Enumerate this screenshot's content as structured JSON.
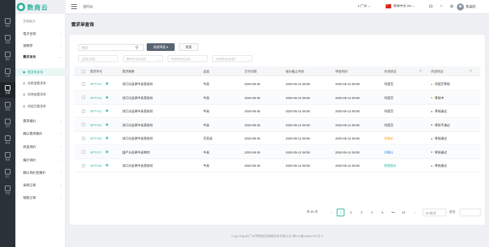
{
  "app": {
    "brand": "数商云",
    "colors": {
      "accent": "#2ab39e",
      "rail_bg": "#2b3138",
      "adv_btn": "#5a6572",
      "pending": "#f39c12",
      "ext_blue": "#3a8ee6"
    }
  },
  "rail": [
    {
      "label": "首页",
      "icon": "home-icon"
    },
    {
      "label": "商品",
      "icon": "goods-icon"
    },
    {
      "label": "报价",
      "icon": "quote-icon"
    },
    {
      "label": "订单",
      "icon": "order-icon"
    },
    {
      "label": "交易",
      "icon": "trade-icon"
    },
    {
      "label": "授信",
      "icon": "credit-icon"
    },
    {
      "label": "支付",
      "icon": "payment-icon"
    },
    {
      "label": "物流",
      "icon": "logistics-icon"
    },
    {
      "label": "账单",
      "icon": "bill-icon"
    },
    {
      "label": "加工",
      "icon": "process-icon"
    },
    {
      "label": "系统",
      "icon": "system-icon"
    }
  ],
  "menu": {
    "section_title": "交易助力",
    "items": [
      {
        "label": "电子合同"
      },
      {
        "label": "进销存"
      },
      {
        "label": "需求发布"
      },
      {
        "label": "需求报价"
      },
      {
        "label": "确认需求报价"
      },
      {
        "label": "商品询价"
      },
      {
        "label": "报价询价"
      },
      {
        "label": "确认询价且报价"
      },
      {
        "label": "采购订单"
      },
      {
        "label": "销售订单"
      }
    ],
    "sub_items": [
      {
        "label": "需求单查询"
      },
      {
        "label": "待新增需求单"
      },
      {
        "label": "待审核需求单"
      },
      {
        "label": "待提交需求单"
      }
    ]
  },
  "topbar": {
    "breadcrumb": "国内站",
    "location": "广州",
    "language": "简体中文-ZH",
    "icons": [
      "headset-icon",
      "bell-icon",
      "settings-icon"
    ],
    "user_name": "陈美欣"
  },
  "page": {
    "title": "需求单查询"
  },
  "toolbar": {
    "search_placeholder": "搜索",
    "advanced_label": "高级筛选 ▾",
    "reset_label": "重置"
  },
  "filters": [
    {
      "placeholder": "品类(全部)"
    },
    {
      "placeholder": "需求时间(全部)"
    },
    {
      "placeholder": "外部状态(全部)"
    },
    {
      "placeholder": "内部状态(全部)"
    }
  ],
  "table": {
    "headers": [
      "需求单号",
      "需求摘要",
      "品类",
      "交付日期",
      "报价截止时间",
      "审核时间",
      "外部状态",
      "内部状态"
    ],
    "rows": [
      {
        "code": "SPTY12",
        "summary": "进口头层黄牛皮荔枝纹",
        "category": "牛皮",
        "delivery": "2020-08-25",
        "deadline": "2020-05-12 08:08",
        "audit": "2020-05-12 08:08",
        "external": "待提交",
        "external_tone": "normal",
        "internal": "待提交审核",
        "internal_color": "#f39c12"
      },
      {
        "code": "SPTY13",
        "summary": "进口头层黄牛皮荔枝纹",
        "category": "牛皮",
        "delivery": "2020-08-25",
        "deadline": "2020-05-12 08:08",
        "audit": "2020-05-12 08:08",
        "external": "待提交",
        "external_tone": "normal",
        "internal": "审核中",
        "internal_color": "#f39c12"
      },
      {
        "code": "SPTY14",
        "summary": "进口头层黄牛皮荔枝纹",
        "category": "牛皮",
        "delivery": "2020-08-25",
        "deadline": "2020-05-12 08:08",
        "audit": "2020-05-12 08:08",
        "external": "待提交",
        "external_tone": "normal",
        "internal": "审核通过",
        "internal_color": "#2ab39e"
      },
      {
        "code": "SPTY15",
        "summary": "进口头层黄牛皮荔枝纹",
        "category": "牛皮",
        "delivery": "2020-08-25",
        "deadline": "2020-05-12 08:08",
        "audit": "2020-05-12 08:08",
        "external": "待提交",
        "external_tone": "normal",
        "internal": "审核不通过",
        "internal_color": "#e74c3c"
      },
      {
        "code": "SPTY16",
        "summary": "进口头层黄牛皮荔枝纹",
        "category": "羔羊皮",
        "delivery": "2020-08-25",
        "deadline": "2020-05-12 08:08",
        "audit": "2020-05-12 08:08",
        "external": "待报价",
        "external_tone": "orange",
        "internal": "审核通过",
        "internal_color": "#2ab39e"
      },
      {
        "code": "SPTY17",
        "summary": "国产头层黄牛皮网纹",
        "category": "牛皮",
        "delivery": "2020-08-25",
        "deadline": "2020-05-12 08:08",
        "audit": "2020-05-12 08:08",
        "external": "待确认",
        "external_tone": "blue",
        "internal": "审核通过",
        "internal_color": "#2ab39e"
      },
      {
        "code": "SPTY18",
        "summary": "进口头层黄牛皮荔枝纹",
        "category": "牛皮",
        "delivery": "2020-08-25",
        "deadline": "2020-05-12 08:08",
        "audit": "2020-05-12 08:08",
        "external": "接受报价",
        "external_tone": "green",
        "internal": "审核通过",
        "internal_color": "#2ab39e"
      }
    ]
  },
  "pagination": {
    "total": "共 80 条",
    "prev": "‹",
    "pages": [
      "1",
      "2",
      "3",
      "4",
      "5",
      "•••",
      "10"
    ],
    "next": "›",
    "current": "1",
    "page_size": "10 条/页",
    "goto_label": "前往"
  },
  "footer": "Copy Right©广州市数商云网络科技有限公司 粤ICP备13044787号-5"
}
